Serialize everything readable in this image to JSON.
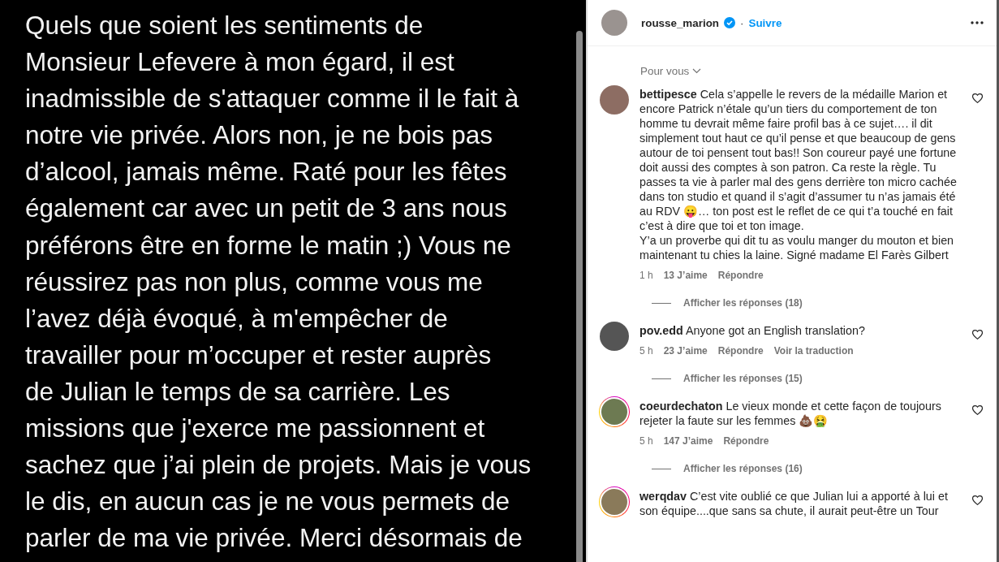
{
  "post_image": {
    "lines": [
      "Quels que soient les sentiments de",
      "Monsieur Lefevere à mon égard, il est",
      "inadmissible de s'attaquer comme il le fait à",
      "notre vie privée. Alors non, je ne bois pas",
      "d’alcool, jamais même. Raté pour les fêtes",
      "également car avec un petit de 3 ans nous",
      "préférons être en forme le matin ;) Vous ne",
      "réussirez pas non plus, comme vous me",
      "l’avez déjà évoqué, à m'empêcher de",
      "travailler pour m’occuper et rester auprès",
      "de Julian le temps de sa carrière. Les",
      "missions que j'exerce me passionnent et",
      "sachez que j’ai plein de projets. Mais je vous",
      "le dis, en aucun cas je ne vous permets de",
      "parler de ma vie privée. Merci désormais de"
    ]
  },
  "header": {
    "username": "rousse_marion",
    "verified": true,
    "separator": "·",
    "follow": "Suivre"
  },
  "sort": {
    "label": "Pour vous"
  },
  "comments": [
    {
      "username": "bettipesce",
      "text": "Cela s’appelle le revers de la médaille Marion et encore Patrick n’étale qu’un tiers du comportement de ton homme tu devrait même faire profil bas à ce sujet…. il dit simplement tout haut ce qu’il pense et que beaucoup de gens autour de toi pensent tout bas!! Son coureur payé une fortune doit aussi des comptes à son patron. Ca reste la règle. Tu passes ta vie à parler mal des gens derrière ton micro cachée dans ton studio et quand il s’agit d’assumer tu n’as jamais été au RDV 😛… ton post est le reflet de ce qui t’a touché en fait c’est à dire que toi et ton image.\nY’a un proverbe qui dit tu as voulu manger du mouton et bien maintenant tu chies la laine. Signé madame El Farès Gilbert",
      "story_ring": false,
      "time": "1 h",
      "likes": "13 J’aime",
      "reply": "Répondre",
      "replies": "Afficher les réponses (18)"
    },
    {
      "username": "pov.edd",
      "text": "Anyone got an English translation?",
      "story_ring": false,
      "time": "5 h",
      "likes": "23 J’aime",
      "reply": "Répondre",
      "translate": "Voir la traduction",
      "replies": "Afficher les réponses (15)"
    },
    {
      "username": "coeurdechaton",
      "text": "Le vieux monde et cette façon de toujours rejeter la faute sur les femmes 💩🤮",
      "story_ring": true,
      "time": "5 h",
      "likes": "147 J’aime",
      "reply": "Répondre",
      "replies": "Afficher les réponses (16)"
    },
    {
      "username": "werqdav",
      "text": "C’est vite oublié ce que Julian lui a apporté à lui et son équipe....que sans sa chute, il aurait peut-être un Tour",
      "story_ring": true
    }
  ]
}
